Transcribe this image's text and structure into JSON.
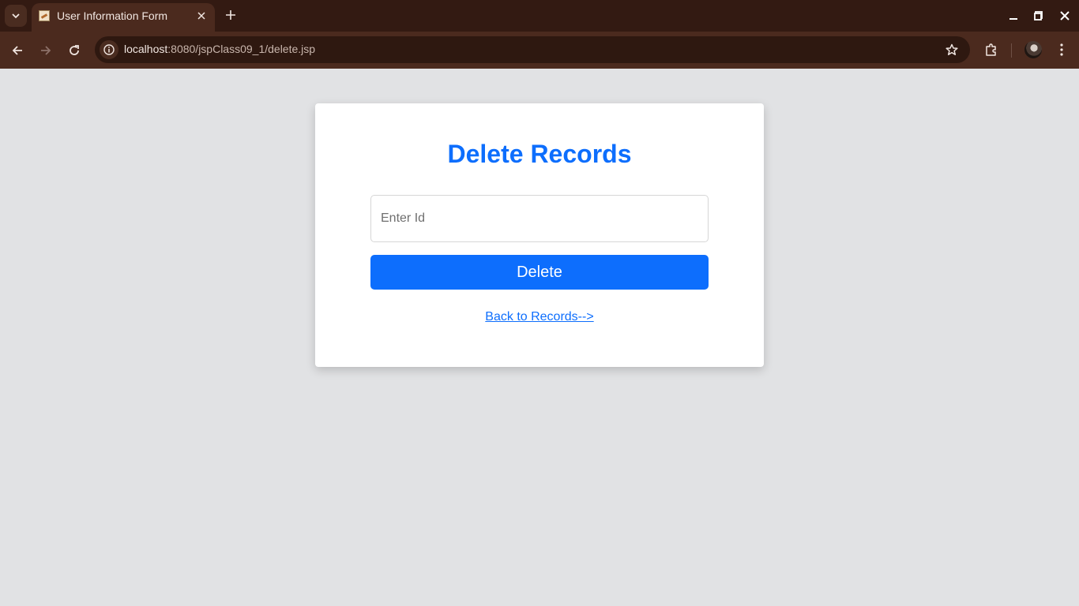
{
  "browser": {
    "tab_title": "User Information Form",
    "url_host": "localhost",
    "url_path": ":8080/jspClass09_1/delete.jsp",
    "icons": [
      "chevron-down-icon",
      "close-icon",
      "plus-icon",
      "minimize-icon",
      "maximize-icon",
      "back-arrow-icon",
      "forward-arrow-icon",
      "reload-icon",
      "info-icon",
      "star-icon",
      "puzzle-icon",
      "kebab-menu-icon"
    ]
  },
  "page": {
    "title": "Delete Records",
    "id_placeholder": "Enter Id",
    "id_value": "",
    "delete_label": "Delete",
    "back_link_label": "Back to Records-->"
  },
  "colors": {
    "accent": "#0d6efd",
    "page_background": "#e1e2e4",
    "browser_frame": "#3a1f15"
  }
}
